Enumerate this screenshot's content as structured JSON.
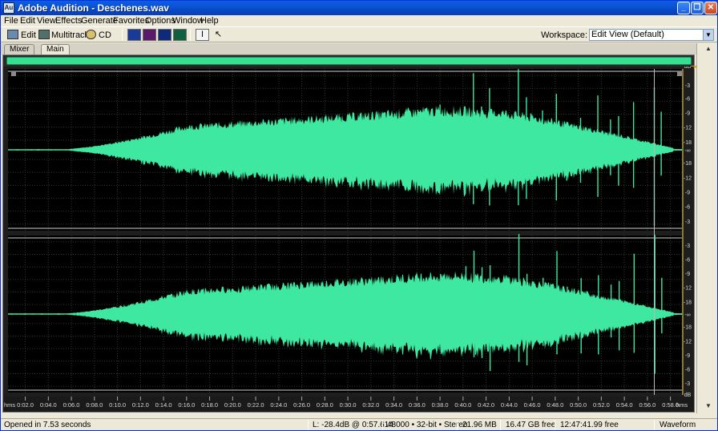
{
  "window": {
    "title": "Adobe Audition - Deschenes.wav",
    "icon_text": "Au"
  },
  "menu": [
    "File",
    "Edit",
    "View",
    "Effects",
    "Generate",
    "Favorites",
    "Options",
    "Window",
    "Help"
  ],
  "toolbar": {
    "edit_label": "Edit",
    "multitrack_label": "Multitrack",
    "cd_label": "CD",
    "workspace_label": "Workspace:",
    "workspace_value": "Edit View (Default)"
  },
  "tabs": [
    {
      "label": "Mixer",
      "active": false
    },
    {
      "label": "Main",
      "active": true
    }
  ],
  "waveform": {
    "color": "#3fe8a0",
    "background": "#000000",
    "db_scale_top": [
      "dB",
      "-3",
      "-6",
      "-9",
      "-12",
      "-18",
      "-∞",
      "-18",
      "-12",
      "-9",
      "-6",
      "-3"
    ],
    "db_scale_bottom": [
      "-3",
      "-6",
      "-9",
      "-12",
      "-18",
      "-∞",
      "-18",
      "-12",
      "-9",
      "-6",
      "-3",
      "dB"
    ],
    "time_unit": "hms",
    "time_labels": [
      "0:02.0",
      "0:04.0",
      "0:06.0",
      "0:08.0",
      "0:10.0",
      "0:12.0",
      "0:14.0",
      "0:16.0",
      "0:18.0",
      "0:20.0",
      "0:22.0",
      "0:24.0",
      "0:26.0",
      "0:28.0",
      "0:30.0",
      "0:32.0",
      "0:34.0",
      "0:36.0",
      "0:38.0",
      "0:40.0",
      "0:42.0",
      "0:44.0",
      "0:46.0",
      "0:48.0",
      "0:50.0",
      "0:52.0",
      "0:54.0",
      "0:56.0",
      "0:58.0"
    ]
  },
  "status": {
    "message": "Opened in 7.53 seconds",
    "level": "L: -28.4dB @   0:57.614",
    "format": "48000 • 32-bit • Stereo",
    "size": "21.96 MB",
    "free_space": "16.47 GB free",
    "free_time": "12:47:41.99 free",
    "view": "Waveform"
  }
}
